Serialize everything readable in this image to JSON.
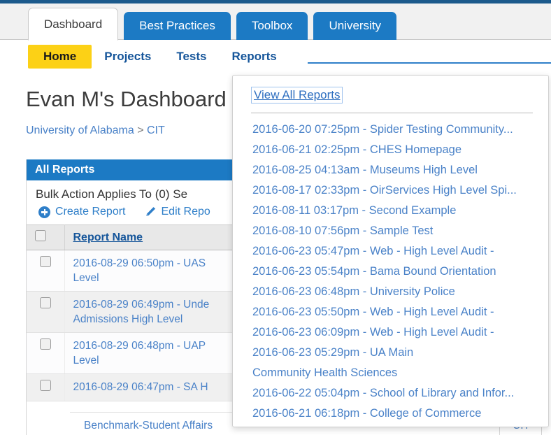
{
  "colors": {
    "brand_blue": "#1c7ac4",
    "dark_blue_strip": "#1c5a8c",
    "link_blue": "#4a82c8",
    "nav_blue": "#15559a",
    "home_yellow": "#fcd116"
  },
  "tabs": [
    {
      "label": "Dashboard",
      "active": true
    },
    {
      "label": "Best Practices",
      "active": false
    },
    {
      "label": "Toolbox",
      "active": false
    },
    {
      "label": "University",
      "active": false
    }
  ],
  "subnav": [
    {
      "label": "Home",
      "active": true
    },
    {
      "label": "Projects",
      "active": false
    },
    {
      "label": "Tests",
      "active": false
    },
    {
      "label": "Reports",
      "active": false
    }
  ],
  "page": {
    "title": "Evan M's Dashboard",
    "breadcrumb_root": "University of Alabama",
    "breadcrumb_sep": ">",
    "breadcrumb_leaf": "CIT"
  },
  "panel": {
    "header": "All Reports",
    "bulk_text": "Bulk Action Applies To (0) Se",
    "actions": [
      {
        "label": "Create Report",
        "icon": "plus-circle-icon"
      },
      {
        "label": "Edit Repo",
        "icon": "pencil-icon"
      }
    ],
    "table": {
      "columns": [
        "",
        "Report Name"
      ],
      "rows": [
        {
          "name": "2016-08-29 06:50pm - UAS",
          "name2": "Level"
        },
        {
          "name": "2016-08-29 06:49pm - Unde",
          "name2": "Admissions High Level"
        },
        {
          "name": "2016-08-29 06:48pm - UAP",
          "name2": "Level"
        },
        {
          "name": "2016-08-29 06:47pm - SA H",
          "name2": ""
        }
      ],
      "hidden_row_text": "Benchmark-Student Affairs",
      "hidden_row_col": "CIT"
    }
  },
  "dropdown": {
    "view_all_label": "View All Reports",
    "items": [
      "2016-06-20 07:25pm - Spider Testing Community...",
      "2016-06-21 02:25pm - CHES Homepage",
      "2016-08-25 04:13am - Museums High Level",
      "2016-08-17 02:33pm - OirServices High Level Spi...",
      "2016-08-11 03:17pm - Second Example",
      "2016-08-10 07:56pm - Sample Test",
      "2016-06-23 05:47pm - Web - High Level Audit -",
      "2016-06-23 05:54pm - Bama Bound Orientation",
      "2016-06-23 06:48pm - University Police",
      "2016-06-23 05:50pm - Web - High Level Audit -",
      "2016-06-23 06:09pm - Web - High Level Audit -",
      "2016-06-23 05:29pm - UA Main",
      "Community Health Sciences",
      "2016-06-22 05:04pm - School of Library and Infor...",
      "2016-06-21 06:18pm - College of Commerce"
    ]
  }
}
